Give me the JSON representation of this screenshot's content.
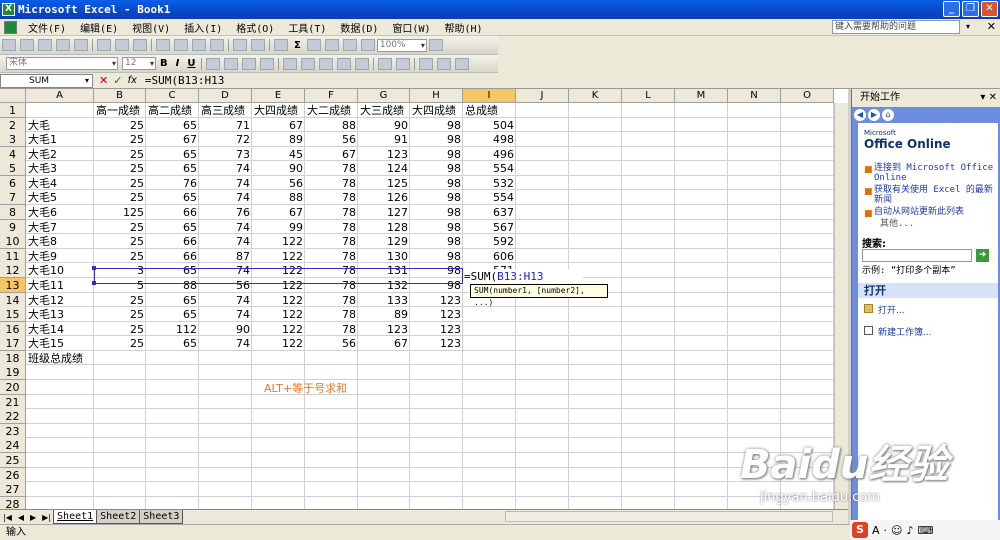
{
  "window": {
    "title": "Microsoft Excel - Book1",
    "icon": "excel-icon"
  },
  "menu": {
    "items": [
      "文件(F)",
      "编辑(E)",
      "视图(V)",
      "插入(I)",
      "格式(O)",
      "工具(T)",
      "数据(D)",
      "窗口(W)",
      "帮助(H)"
    ],
    "help_placeholder": "键入需要帮助的问题"
  },
  "toolbar": {
    "zoom": "100%",
    "font": "宋体",
    "size": "12",
    "bold": "B",
    "italic": "I",
    "underline": "U",
    "sigma": "Σ"
  },
  "formula_bar": {
    "name_box": "SUM",
    "formula": "=SUM(B13:H13"
  },
  "columns": [
    "A",
    "B",
    "C",
    "D",
    "E",
    "F",
    "G",
    "H",
    "I",
    "J",
    "K",
    "L",
    "M",
    "N",
    "O"
  ],
  "rows": [
    "1",
    "2",
    "3",
    "4",
    "5",
    "6",
    "7",
    "8",
    "9",
    "10",
    "11",
    "12",
    "13",
    "14",
    "15",
    "16",
    "17",
    "18",
    "19",
    "20",
    "21",
    "22",
    "23",
    "24",
    "25",
    "26",
    "27",
    "28",
    "29"
  ],
  "headers": [
    "",
    "高一成绩",
    "高二成绩",
    "高三成绩",
    "大四成绩",
    "大二成绩",
    "大三成绩",
    "大四成绩",
    "总成绩"
  ],
  "data": [
    [
      "大毛",
      25,
      65,
      71,
      67,
      88,
      90,
      98,
      504
    ],
    [
      "大毛1",
      25,
      67,
      72,
      89,
      56,
      91,
      98,
      498
    ],
    [
      "大毛2",
      25,
      65,
      73,
      45,
      67,
      123,
      98,
      496
    ],
    [
      "大毛3",
      25,
      65,
      74,
      90,
      78,
      124,
      98,
      554
    ],
    [
      "大毛4",
      25,
      76,
      74,
      56,
      78,
      125,
      98,
      532
    ],
    [
      "大毛5",
      25,
      65,
      74,
      88,
      78,
      126,
      98,
      554
    ],
    [
      "大毛6",
      125,
      66,
      76,
      67,
      78,
      127,
      98,
      637
    ],
    [
      "大毛7",
      25,
      65,
      74,
      99,
      78,
      128,
      98,
      567
    ],
    [
      "大毛8",
      25,
      66,
      74,
      122,
      78,
      129,
      98,
      592
    ],
    [
      "大毛9",
      25,
      66,
      87,
      122,
      78,
      130,
      98,
      606
    ],
    [
      "大毛10",
      3,
      65,
      74,
      122,
      78,
      131,
      98,
      571
    ],
    [
      "大毛11",
      5,
      88,
      56,
      122,
      78,
      132,
      98,
      ""
    ],
    [
      "大毛12",
      25,
      65,
      74,
      122,
      78,
      133,
      123,
      ""
    ],
    [
      "大毛13",
      25,
      65,
      74,
      122,
      78,
      89,
      123,
      ""
    ],
    [
      "大毛14",
      25,
      112,
      90,
      122,
      78,
      123,
      123,
      ""
    ],
    [
      "大毛15",
      25,
      65,
      74,
      122,
      56,
      67,
      123,
      ""
    ]
  ],
  "footer_label": "班级总成绩",
  "editing": {
    "prefix": "=SUM(",
    "ref": "B13:H13",
    "tooltip": "SUM(number1, [number2], ...)"
  },
  "annotation": "ALT+等于号求和",
  "sheets": [
    "Sheet1",
    "Sheet2",
    "Sheet3"
  ],
  "status": "输入",
  "task_pane": {
    "title": "开始工作",
    "logo_small": "Microsoft",
    "logo": "Office Online",
    "links": [
      "连接到 Microsoft Office Online",
      "获取有关使用 Excel 的最新新闻",
      "自动从网站更新此列表"
    ],
    "more": "其他...",
    "search_label": "搜索:",
    "example": "示例: “打印多个副本”",
    "open_section": "打开",
    "open_item": "打开...",
    "new_item": "新建工作簿..."
  },
  "watermark": {
    "brand": "Baidu经验",
    "url": "jingyan.baidu.com"
  }
}
